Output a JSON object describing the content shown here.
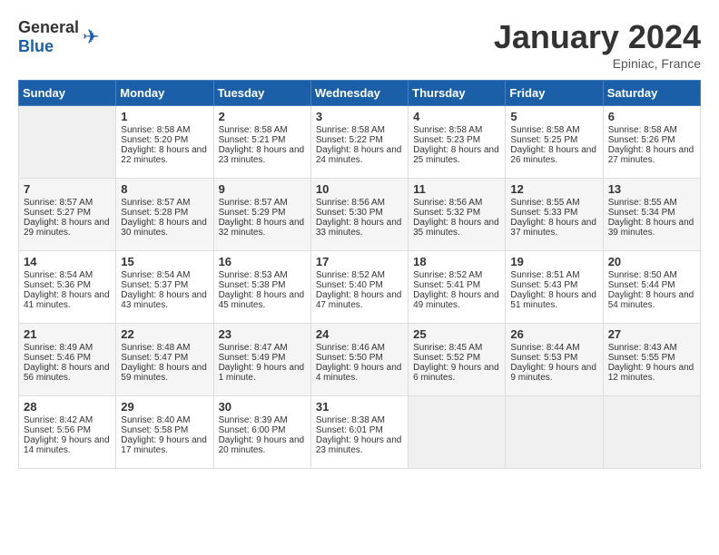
{
  "header": {
    "logo_general": "General",
    "logo_blue": "Blue",
    "title": "January 2024",
    "location": "Epiniac, France"
  },
  "calendar": {
    "days_of_week": [
      "Sunday",
      "Monday",
      "Tuesday",
      "Wednesday",
      "Thursday",
      "Friday",
      "Saturday"
    ],
    "weeks": [
      [
        {
          "day": "",
          "empty": true
        },
        {
          "day": "1",
          "sunrise": "8:58 AM",
          "sunset": "5:20 PM",
          "daylight": "8 hours and 22 minutes."
        },
        {
          "day": "2",
          "sunrise": "8:58 AM",
          "sunset": "5:21 PM",
          "daylight": "8 hours and 23 minutes."
        },
        {
          "day": "3",
          "sunrise": "8:58 AM",
          "sunset": "5:22 PM",
          "daylight": "8 hours and 24 minutes."
        },
        {
          "day": "4",
          "sunrise": "8:58 AM",
          "sunset": "5:23 PM",
          "daylight": "8 hours and 25 minutes."
        },
        {
          "day": "5",
          "sunrise": "8:58 AM",
          "sunset": "5:25 PM",
          "daylight": "8 hours and 26 minutes."
        },
        {
          "day": "6",
          "sunrise": "8:58 AM",
          "sunset": "5:26 PM",
          "daylight": "8 hours and 27 minutes."
        }
      ],
      [
        {
          "day": "7",
          "sunrise": "8:57 AM",
          "sunset": "5:27 PM",
          "daylight": "8 hours and 29 minutes."
        },
        {
          "day": "8",
          "sunrise": "8:57 AM",
          "sunset": "5:28 PM",
          "daylight": "8 hours and 30 minutes."
        },
        {
          "day": "9",
          "sunrise": "8:57 AM",
          "sunset": "5:29 PM",
          "daylight": "8 hours and 32 minutes."
        },
        {
          "day": "10",
          "sunrise": "8:56 AM",
          "sunset": "5:30 PM",
          "daylight": "8 hours and 33 minutes."
        },
        {
          "day": "11",
          "sunrise": "8:56 AM",
          "sunset": "5:32 PM",
          "daylight": "8 hours and 35 minutes."
        },
        {
          "day": "12",
          "sunrise": "8:55 AM",
          "sunset": "5:33 PM",
          "daylight": "8 hours and 37 minutes."
        },
        {
          "day": "13",
          "sunrise": "8:55 AM",
          "sunset": "5:34 PM",
          "daylight": "8 hours and 39 minutes."
        }
      ],
      [
        {
          "day": "14",
          "sunrise": "8:54 AM",
          "sunset": "5:36 PM",
          "daylight": "8 hours and 41 minutes."
        },
        {
          "day": "15",
          "sunrise": "8:54 AM",
          "sunset": "5:37 PM",
          "daylight": "8 hours and 43 minutes."
        },
        {
          "day": "16",
          "sunrise": "8:53 AM",
          "sunset": "5:38 PM",
          "daylight": "8 hours and 45 minutes."
        },
        {
          "day": "17",
          "sunrise": "8:52 AM",
          "sunset": "5:40 PM",
          "daylight": "8 hours and 47 minutes."
        },
        {
          "day": "18",
          "sunrise": "8:52 AM",
          "sunset": "5:41 PM",
          "daylight": "8 hours and 49 minutes."
        },
        {
          "day": "19",
          "sunrise": "8:51 AM",
          "sunset": "5:43 PM",
          "daylight": "8 hours and 51 minutes."
        },
        {
          "day": "20",
          "sunrise": "8:50 AM",
          "sunset": "5:44 PM",
          "daylight": "8 hours and 54 minutes."
        }
      ],
      [
        {
          "day": "21",
          "sunrise": "8:49 AM",
          "sunset": "5:46 PM",
          "daylight": "8 hours and 56 minutes."
        },
        {
          "day": "22",
          "sunrise": "8:48 AM",
          "sunset": "5:47 PM",
          "daylight": "8 hours and 59 minutes."
        },
        {
          "day": "23",
          "sunrise": "8:47 AM",
          "sunset": "5:49 PM",
          "daylight": "9 hours and 1 minute."
        },
        {
          "day": "24",
          "sunrise": "8:46 AM",
          "sunset": "5:50 PM",
          "daylight": "9 hours and 4 minutes."
        },
        {
          "day": "25",
          "sunrise": "8:45 AM",
          "sunset": "5:52 PM",
          "daylight": "9 hours and 6 minutes."
        },
        {
          "day": "26",
          "sunrise": "8:44 AM",
          "sunset": "5:53 PM",
          "daylight": "9 hours and 9 minutes."
        },
        {
          "day": "27",
          "sunrise": "8:43 AM",
          "sunset": "5:55 PM",
          "daylight": "9 hours and 12 minutes."
        }
      ],
      [
        {
          "day": "28",
          "sunrise": "8:42 AM",
          "sunset": "5:56 PM",
          "daylight": "9 hours and 14 minutes."
        },
        {
          "day": "29",
          "sunrise": "8:40 AM",
          "sunset": "5:58 PM",
          "daylight": "9 hours and 17 minutes."
        },
        {
          "day": "30",
          "sunrise": "8:39 AM",
          "sunset": "6:00 PM",
          "daylight": "9 hours and 20 minutes."
        },
        {
          "day": "31",
          "sunrise": "8:38 AM",
          "sunset": "6:01 PM",
          "daylight": "9 hours and 23 minutes."
        },
        {
          "day": "",
          "empty": true
        },
        {
          "day": "",
          "empty": true
        },
        {
          "day": "",
          "empty": true
        }
      ]
    ]
  },
  "labels": {
    "sunrise": "Sunrise:",
    "sunset": "Sunset:",
    "daylight": "Daylight:"
  }
}
